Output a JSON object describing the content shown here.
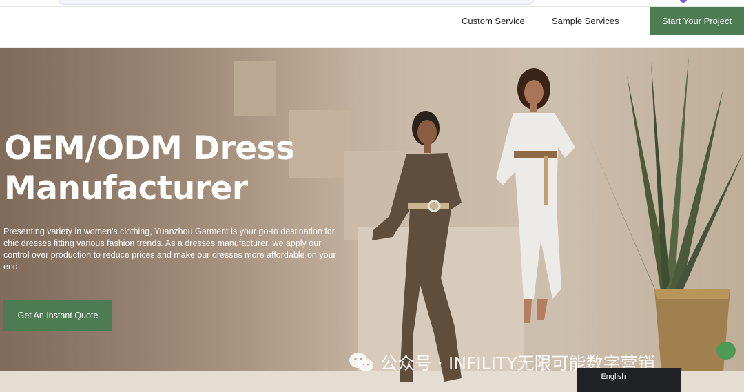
{
  "nav": {
    "links": [
      "Custom Service",
      "Sample Services"
    ],
    "cta_label": "Start Your Project"
  },
  "hero": {
    "title": "OEM/ODM Dress Manufacturer",
    "description": "Presenting variety in women's clothing, Yuanzhou Garment is your go-to destination for chic dresses fitting various fashion trends. As a dresses manufacturer, we apply our control over production to reduce prices and make our dresses more affordable on your end.",
    "quote_button": "Get An Instant Quote"
  },
  "watermark": {
    "text": "公众号 · INFILITY无限可能数字营销",
    "icon": "wechat-icon"
  },
  "language": {
    "selected": "English"
  },
  "colors": {
    "accent_green": "#4d7c53",
    "nav_text": "#222222",
    "language_bar": "#202124"
  }
}
